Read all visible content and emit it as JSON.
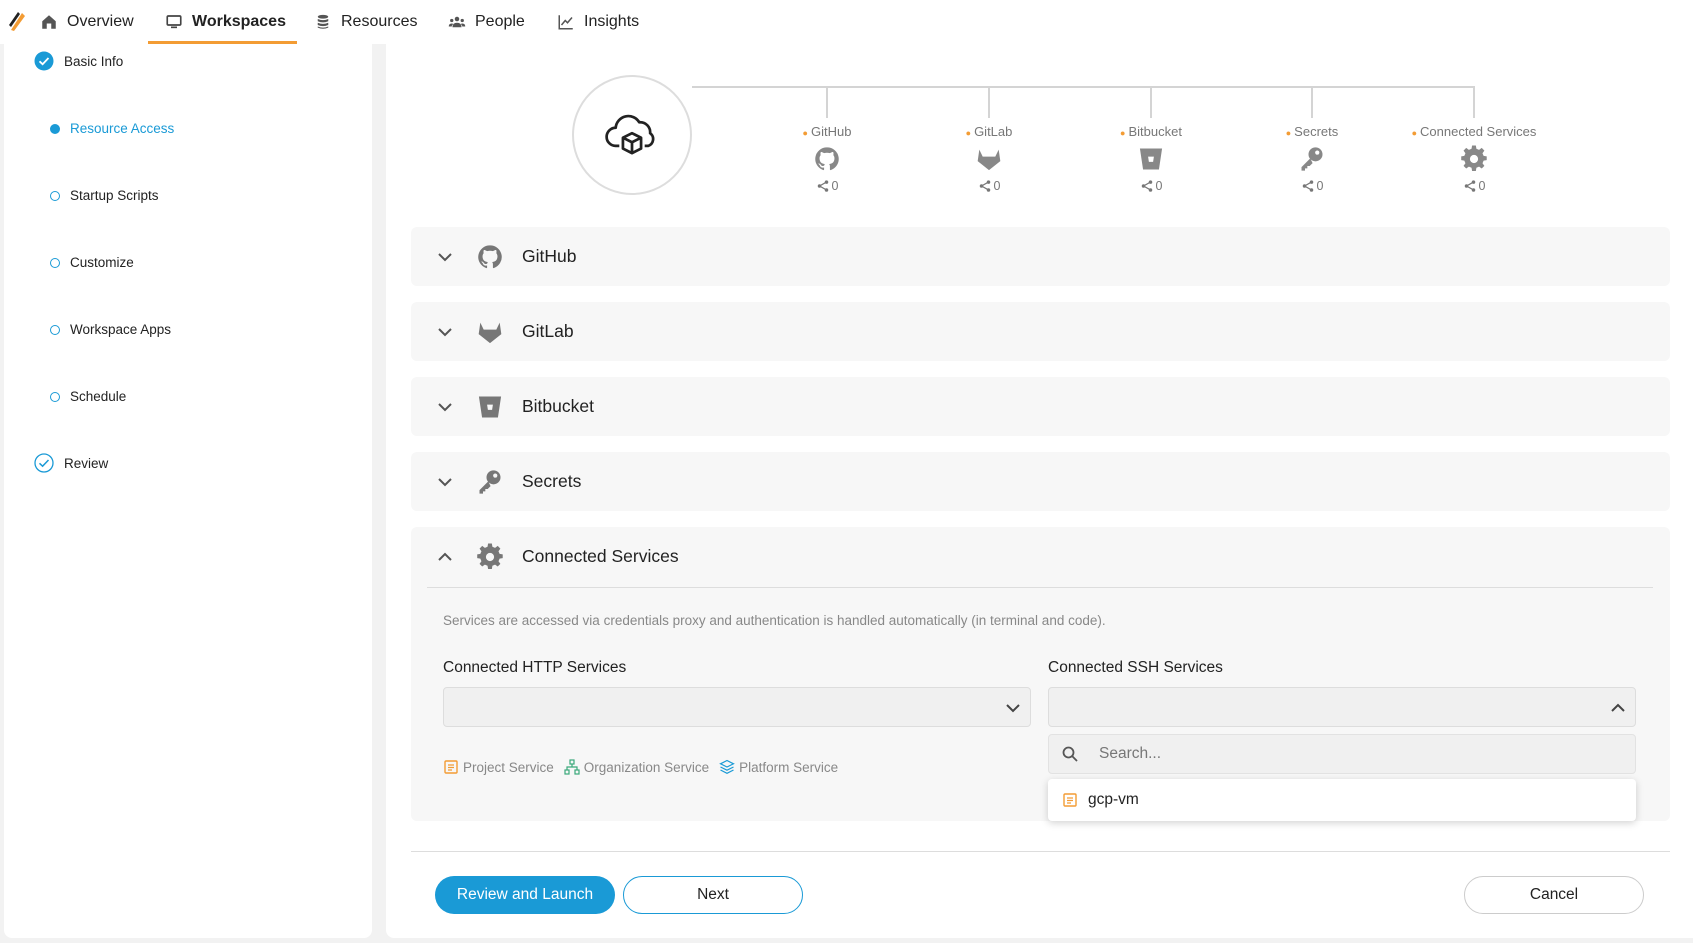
{
  "nav": {
    "items": [
      {
        "label": "Overview",
        "icon": "home-icon"
      },
      {
        "label": "Workspaces",
        "icon": "monitor-icon",
        "active": true
      },
      {
        "label": "Resources",
        "icon": "database-icon"
      },
      {
        "label": "People",
        "icon": "people-icon"
      },
      {
        "label": "Insights",
        "icon": "chart-line-icon"
      }
    ]
  },
  "sidebar": {
    "steps": [
      {
        "label": "Basic Info",
        "state": "complete"
      },
      {
        "label": "Resource Access",
        "state": "active"
      },
      {
        "label": "Startup Scripts",
        "state": "pending"
      },
      {
        "label": "Customize",
        "state": "pending"
      },
      {
        "label": "Workspace Apps",
        "state": "pending"
      },
      {
        "label": "Schedule",
        "state": "pending"
      },
      {
        "label": "Review",
        "state": "pending"
      }
    ]
  },
  "tree": {
    "nodes": [
      {
        "label": "GitHub",
        "icon": "github-icon",
        "count": "0"
      },
      {
        "label": "GitLab",
        "icon": "gitlab-icon",
        "count": "0"
      },
      {
        "label": "Bitbucket",
        "icon": "bitbucket-icon",
        "count": "0"
      },
      {
        "label": "Secrets",
        "icon": "key-icon",
        "count": "0"
      },
      {
        "label": "Connected Services",
        "icon": "gear-icon",
        "count": "0"
      }
    ]
  },
  "accordions": [
    {
      "title": "GitHub",
      "icon": "github-icon",
      "expanded": false
    },
    {
      "title": "GitLab",
      "icon": "gitlab-icon",
      "expanded": false
    },
    {
      "title": "Bitbucket",
      "icon": "bitbucket-icon",
      "expanded": false
    },
    {
      "title": "Secrets",
      "icon": "key-icon",
      "expanded": false
    },
    {
      "title": "Connected Services",
      "icon": "gear-icon",
      "expanded": true
    }
  ],
  "connected": {
    "description": "Services are accessed via credentials proxy and authentication is handled automatically (in terminal and code).",
    "http_label": "Connected HTTP Services",
    "http_value": "",
    "ssh_label": "Connected SSH Services",
    "ssh_value": "",
    "legend": [
      "Project Service",
      "Organization Service",
      "Platform Service"
    ],
    "search_placeholder": "Search...",
    "options": [
      "gcp-vm"
    ]
  },
  "footer": {
    "review_launch": "Review and Launch",
    "next": "Next",
    "cancel": "Cancel"
  },
  "colors": {
    "accent": "#1a9ad6",
    "nav_active": "#f39c34",
    "project_service": "#f39c34",
    "org_service": "#3aa87a",
    "platform_service": "#1a9ad6"
  }
}
